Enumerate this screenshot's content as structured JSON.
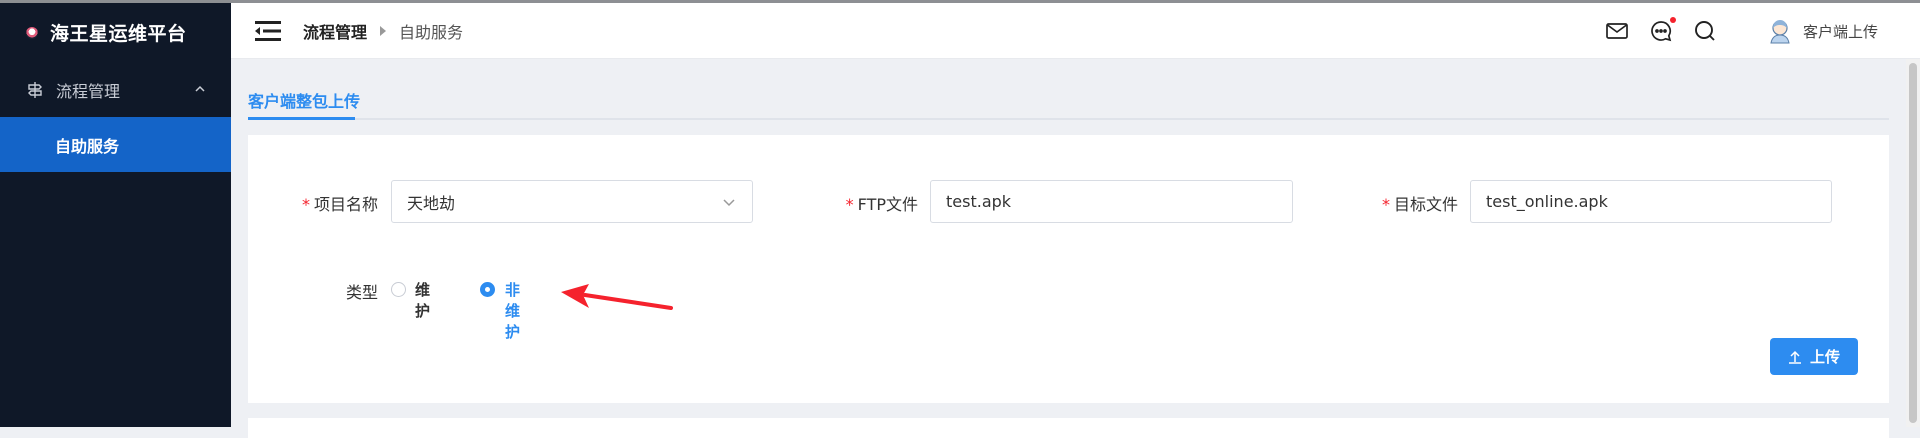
{
  "sidebar": {
    "brand": "海王星运维平台",
    "group_label": "流程管理",
    "active_item": "自助服务"
  },
  "header": {
    "breadcrumb_1": "流程管理",
    "breadcrumb_2": "自助服务",
    "user_name": "客户端上传"
  },
  "tabs": {
    "active": "客户端整包上传"
  },
  "form": {
    "project_label": "项目名称",
    "project_value": "天地劫",
    "ftp_label": "FTP文件",
    "ftp_value": "test.apk",
    "target_label": "目标文件",
    "target_value": "test_online.apk",
    "type_label": "类型",
    "radio_options": [
      "维护",
      "非维护"
    ],
    "selected_option": "非维护",
    "required_mark": "*"
  },
  "actions": {
    "upload_label": "上传"
  },
  "colors": {
    "sidebar_bg": "#0f1828",
    "active_menu": "#1464c8",
    "primary": "#2d8cf0",
    "annotation_arrow": "#f5222d"
  }
}
